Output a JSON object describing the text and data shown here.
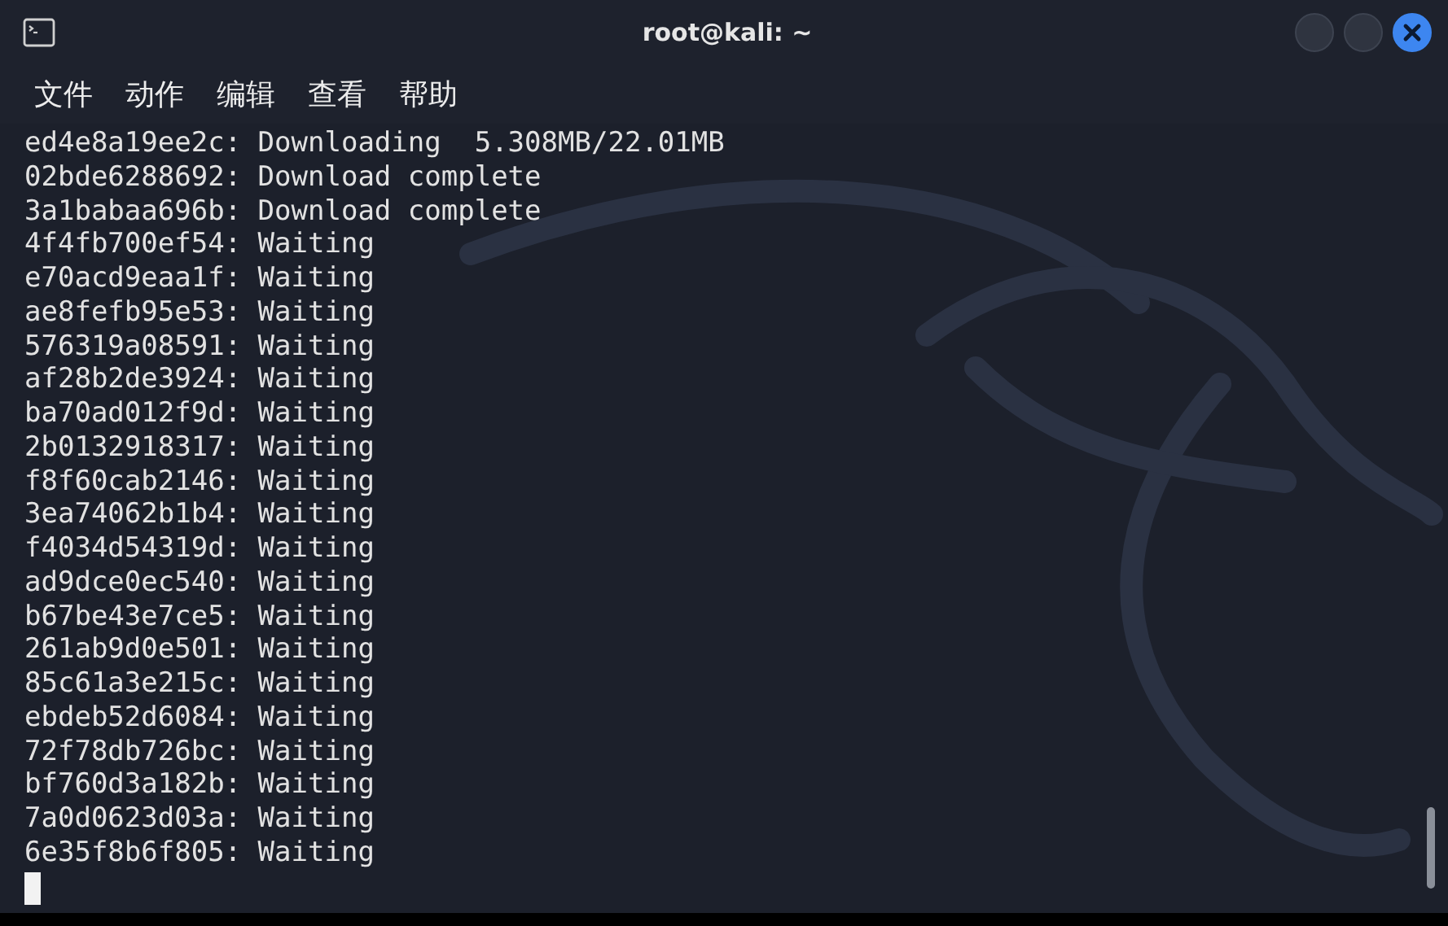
{
  "window": {
    "title": "root@kali: ~"
  },
  "menu": [
    "文件",
    "动作",
    "编辑",
    "查看",
    "帮助"
  ],
  "terminal": {
    "lines": [
      "ed4e8a19ee2c: Downloading  5.308MB/22.01MB",
      "02bde6288692: Download complete",
      "3a1babaa696b: Download complete",
      "4f4fb700ef54: Waiting",
      "e70acd9eaa1f: Waiting",
      "ae8fefb95e53: Waiting",
      "576319a08591: Waiting",
      "af28b2de3924: Waiting",
      "ba70ad012f9d: Waiting",
      "2b0132918317: Waiting",
      "f8f60cab2146: Waiting",
      "3ea74062b1b4: Waiting",
      "f4034d54319d: Waiting",
      "ad9dce0ec540: Waiting",
      "b67be43e7ce5: Waiting",
      "261ab9d0e501: Waiting",
      "85c61a3e215c: Waiting",
      "ebdeb52d6084: Waiting",
      "72f78db726bc: Waiting",
      "bf760d3a182b: Waiting",
      "7a0d0623d03a: Waiting",
      "6e35f8b6f805: Waiting"
    ]
  }
}
